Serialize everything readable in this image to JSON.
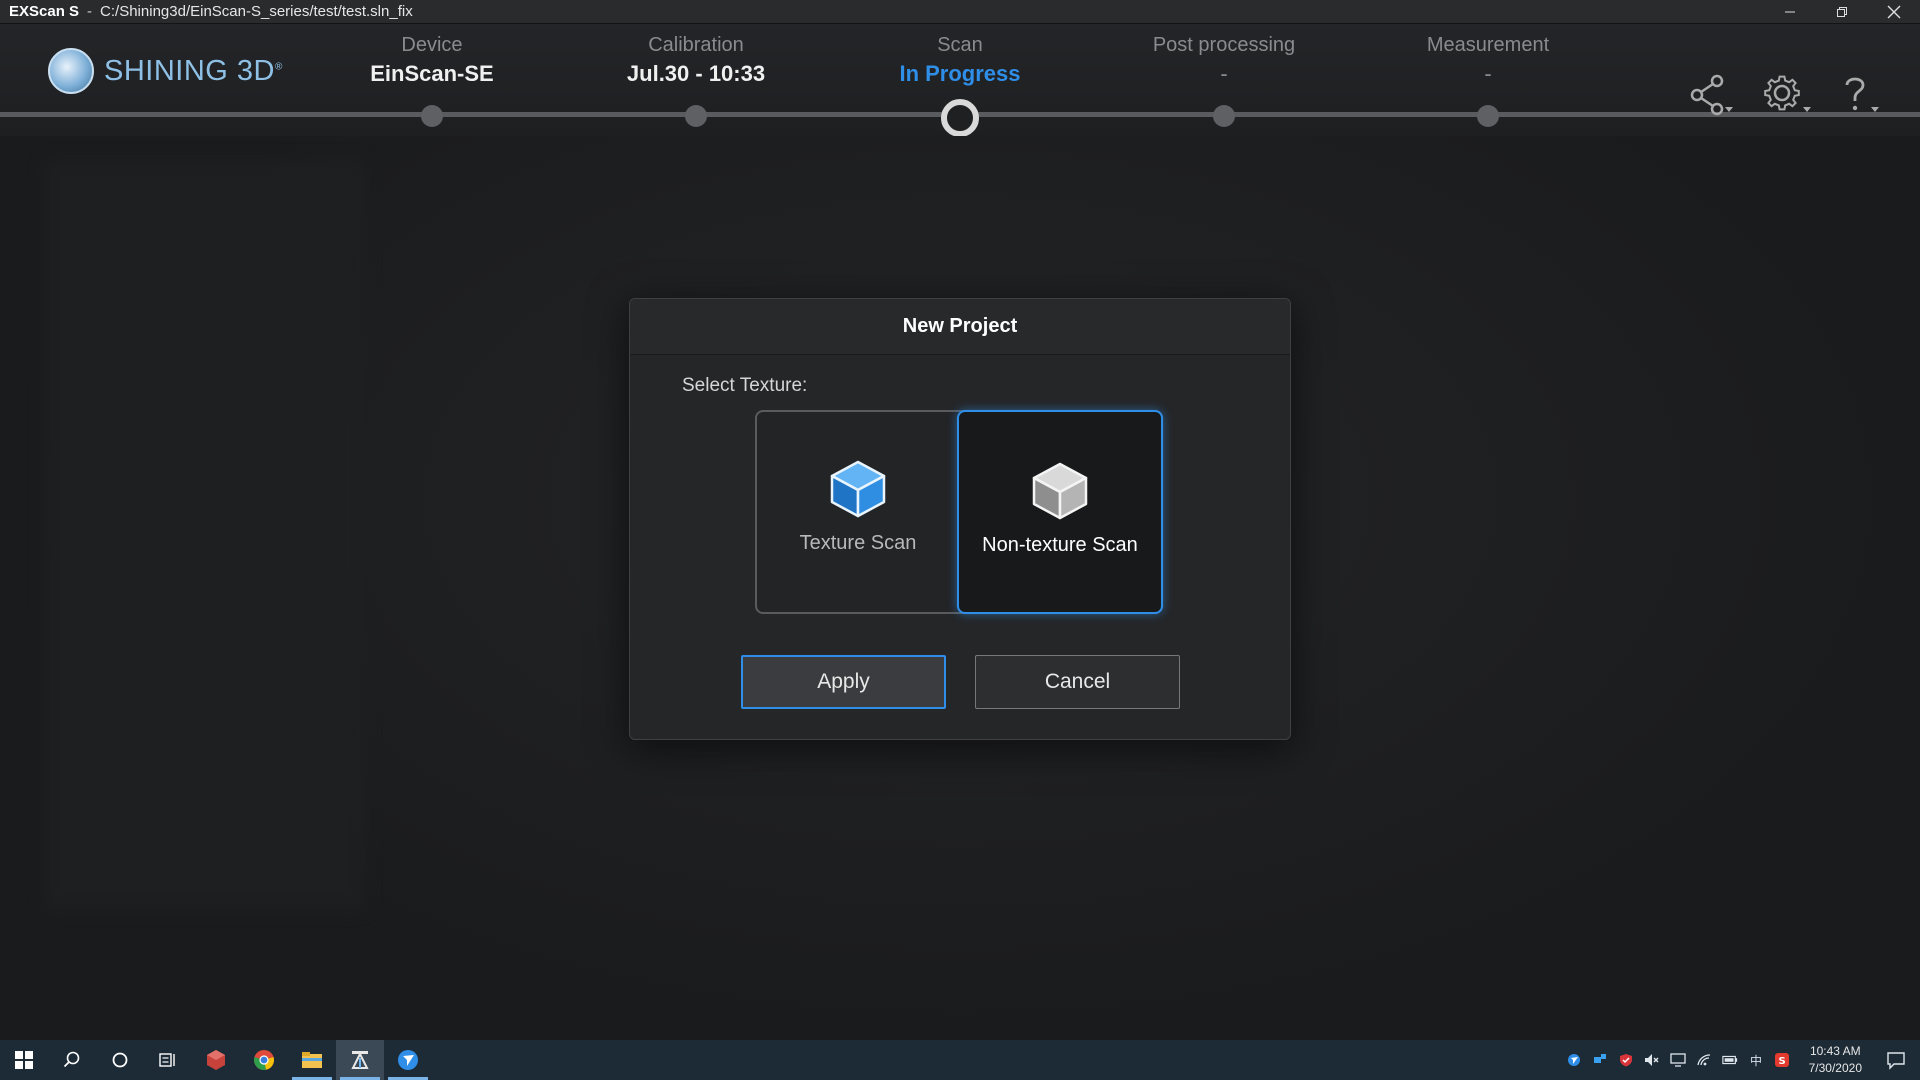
{
  "titlebar": {
    "app": "EXScan S",
    "separator": "-",
    "path": "C:/Shining3d/EinScan-S_series/test/test.sln_fix"
  },
  "logo": {
    "brand": "SHINING 3D",
    "trademark": "®"
  },
  "workflow": {
    "steps": [
      {
        "label": "Device",
        "value": "EinScan-SE",
        "state": "done"
      },
      {
        "label": "Calibration",
        "value": "Jul.30 - 10:33",
        "state": "done"
      },
      {
        "label": "Scan",
        "value": "In Progress",
        "state": "current"
      },
      {
        "label": "Post processing",
        "value": "-",
        "state": "pending"
      },
      {
        "label": "Measurement",
        "value": "-",
        "state": "pending"
      }
    ]
  },
  "dialog": {
    "title": "New Project",
    "select_label": "Select Texture:",
    "options": [
      {
        "label": "Texture Scan",
        "selected": false
      },
      {
        "label": "Non-texture Scan",
        "selected": true
      }
    ],
    "apply_label": "Apply",
    "cancel_label": "Cancel"
  },
  "taskbar": {
    "time": "10:43 AM",
    "date": "7/30/2020",
    "ime": "中"
  },
  "colors": {
    "accent": "#2e8ee8",
    "background": "#1b1c1e",
    "taskbar": "#1d2b36"
  }
}
